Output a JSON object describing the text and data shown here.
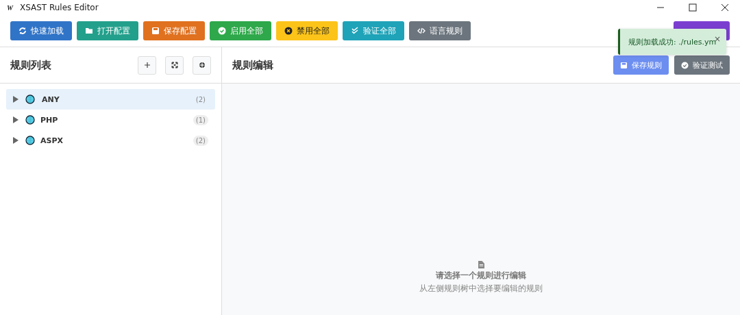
{
  "window": {
    "title": "XSAST Rules Editor",
    "logo": "W"
  },
  "toolbar": [
    {
      "label": "快速加载",
      "color": "#3074c8"
    },
    {
      "label": "打开配置",
      "color": "#23a08c"
    },
    {
      "label": "保存配置",
      "color": "#e0711f"
    },
    {
      "label": "启用全部",
      "color": "#2ea84a"
    },
    {
      "label": "禁用全部",
      "color": "#fcc419"
    },
    {
      "label": "验证全部",
      "color": "#1ea3b8"
    },
    {
      "label": "语言规则",
      "color": "#6c757d"
    }
  ],
  "hidden_button": {
    "color": "#7b3fd0"
  },
  "toast": {
    "message": "规则加载成功: ./rules.ym",
    "close": "×"
  },
  "sidebar": {
    "title": "规则列表",
    "items": [
      {
        "label": "ANY",
        "count": "(2)",
        "selected": true
      },
      {
        "label": "PHP",
        "count": "(1)",
        "selected": false
      },
      {
        "label": "ASPX",
        "count": "(2)",
        "selected": false
      }
    ]
  },
  "editor": {
    "title": "规则编辑",
    "actions": [
      {
        "label": "保存规则",
        "color": "#6c8ef0"
      },
      {
        "label": "验证测试",
        "color": "#6c757d"
      }
    ],
    "empty_title": "请选择一个规则进行编辑",
    "empty_hint": "从左侧规则树中选择要编辑的规则"
  }
}
